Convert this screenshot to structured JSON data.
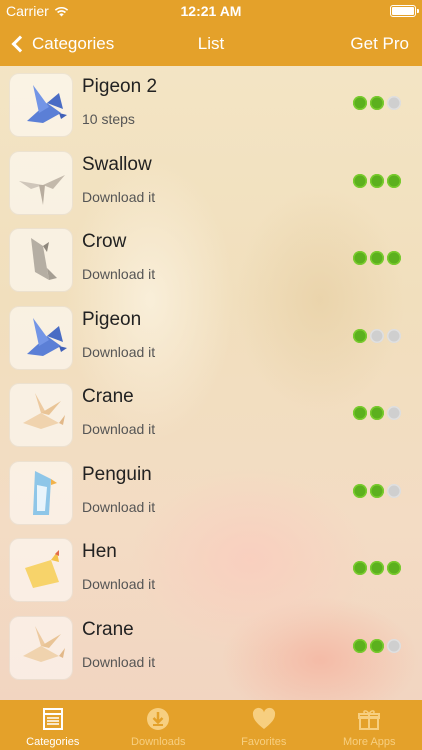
{
  "status_bar": {
    "carrier": "Carrier",
    "time": "12:21 AM"
  },
  "nav": {
    "back_label": "Categories",
    "title": "List",
    "right_label": "Get Pro"
  },
  "items": [
    {
      "title": "Pigeon 2",
      "subtitle": "10 steps",
      "difficulty": 2,
      "icon": "blue-pigeon-origami"
    },
    {
      "title": "Swallow",
      "subtitle": "Download it",
      "difficulty": 3,
      "icon": "swallow-origami"
    },
    {
      "title": "Crow",
      "subtitle": "Download it",
      "difficulty": 3,
      "icon": "crow-origami"
    },
    {
      "title": "Pigeon",
      "subtitle": "Download it",
      "difficulty": 1,
      "icon": "blue-pigeon-origami"
    },
    {
      "title": "Crane",
      "subtitle": "Download it",
      "difficulty": 2,
      "icon": "crane-origami"
    },
    {
      "title": "Penguin",
      "subtitle": "Download it",
      "difficulty": 2,
      "icon": "penguin-origami"
    },
    {
      "title": "Hen",
      "subtitle": "Download it",
      "difficulty": 3,
      "icon": "hen-origami"
    },
    {
      "title": "Crane",
      "subtitle": "Download it",
      "difficulty": 2,
      "icon": "crane-origami"
    }
  ],
  "tabs": [
    {
      "label": "Categories",
      "icon": "list-icon",
      "active": true
    },
    {
      "label": "Downloads",
      "icon": "download-icon",
      "active": false
    },
    {
      "label": "Favorites",
      "icon": "heart-icon",
      "active": false
    },
    {
      "label": "More Apps",
      "icon": "gift-icon",
      "active": false
    }
  ],
  "colors": {
    "accent": "#e4a12a",
    "difficulty_on": "#5cb01e",
    "difficulty_off": "#cfcfcf"
  }
}
